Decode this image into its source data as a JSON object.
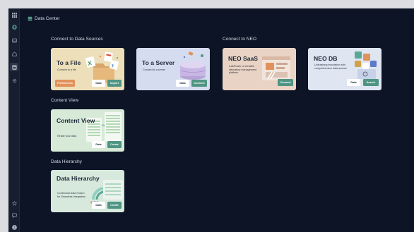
{
  "header": {
    "title": "Data Center",
    "icon": "database-icon"
  },
  "rail": {
    "items": [
      {
        "name": "apps-grid-icon"
      },
      {
        "name": "globe-icon"
      },
      {
        "name": "inbox-icon"
      },
      {
        "name": "home-icon"
      },
      {
        "name": "data-center-icon",
        "active": true
      },
      {
        "name": "settings-icon"
      },
      {
        "name": "star-icon"
      },
      {
        "name": "chat-icon"
      },
      {
        "name": "avatar-icon"
      }
    ]
  },
  "sections": {
    "connect_sources": "Connect to Data Sources",
    "connect_neo": "Connect to NEO",
    "content_view": "Content View",
    "data_hierarchy": "Data Hierarchy"
  },
  "cards": {
    "file": {
      "title": "To a File",
      "desc": "Connect to a file",
      "buttons": [
        "Preferences",
        "Data",
        "Import"
      ]
    },
    "server": {
      "title": "To a Server",
      "desc": "Connect to a server",
      "buttons": [
        "Data",
        "Connect"
      ]
    },
    "neo_saas": {
      "title": "NEO SaaS",
      "desc": "iLabPower, a versatile laboratory management platform",
      "buttons": [
        "Connect"
      ]
    },
    "neo_db": {
      "title": "NEO DB",
      "desc": "Unleashing innovation with comprehensive data access",
      "buttons": [
        "Data",
        "Search"
      ]
    },
    "content_view": {
      "title": "Content View",
      "desc": "Relate your data",
      "buttons": [
        "Data",
        "Create"
      ]
    },
    "data_hierarchy": {
      "title": "Data Hierarchy",
      "desc": "Contextual Data Fusion for Seamless Integration",
      "buttons": [
        "Data",
        "Create"
      ]
    }
  },
  "colors": {
    "background": "#0c1426",
    "rail": "#161e30",
    "teal_button": "#4f9583",
    "orange_button": "#e3915a",
    "file_card": "#ecdfb9",
    "server_card": "#d5dcef",
    "neo_saas_card": "#e9d3c4",
    "neo_db_card": "#dfe5f1",
    "content_view_card": "#d7ead8",
    "data_hierarchy_card": "#d7e8dc"
  }
}
